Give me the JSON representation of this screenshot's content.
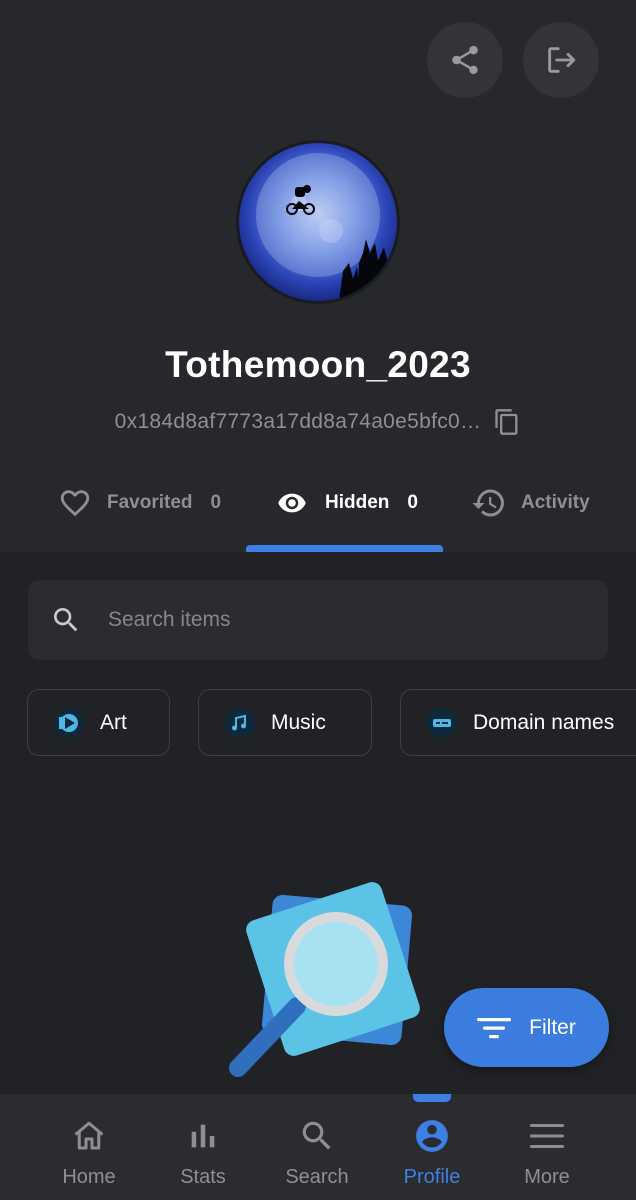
{
  "profile": {
    "username": "Tothemoon_2023",
    "address": "0x184d8af7773a17dd8a74a0e5bfc0…"
  },
  "header": {
    "share_icon": "share-icon",
    "logout_icon": "logout-icon"
  },
  "tabs": [
    {
      "label": "Favorited",
      "count": "0",
      "icon": "heart-outline-icon",
      "active": false
    },
    {
      "label": "Hidden",
      "count": "0",
      "icon": "eye-icon",
      "active": true
    },
    {
      "label": "Activity",
      "icon": "history-icon",
      "active": false
    }
  ],
  "search": {
    "placeholder": "Search items"
  },
  "categories": [
    {
      "label": "Art",
      "icon": "art-icon"
    },
    {
      "label": "Music",
      "icon": "music-icon"
    },
    {
      "label": "Domain names",
      "icon": "domain-icon"
    }
  ],
  "filter": {
    "label": "Filter"
  },
  "bottom_nav": [
    {
      "label": "Home",
      "icon": "home-icon",
      "active": false
    },
    {
      "label": "Stats",
      "icon": "stats-icon",
      "active": false
    },
    {
      "label": "Search",
      "icon": "search-icon",
      "active": false
    },
    {
      "label": "Profile",
      "icon": "profile-icon",
      "active": true
    },
    {
      "label": "More",
      "icon": "menu-icon",
      "active": false
    }
  ],
  "colors": {
    "background": "#212226",
    "header_background": "#27282c",
    "accent": "#3d7fe3",
    "muted_text": "#8e8f93"
  }
}
